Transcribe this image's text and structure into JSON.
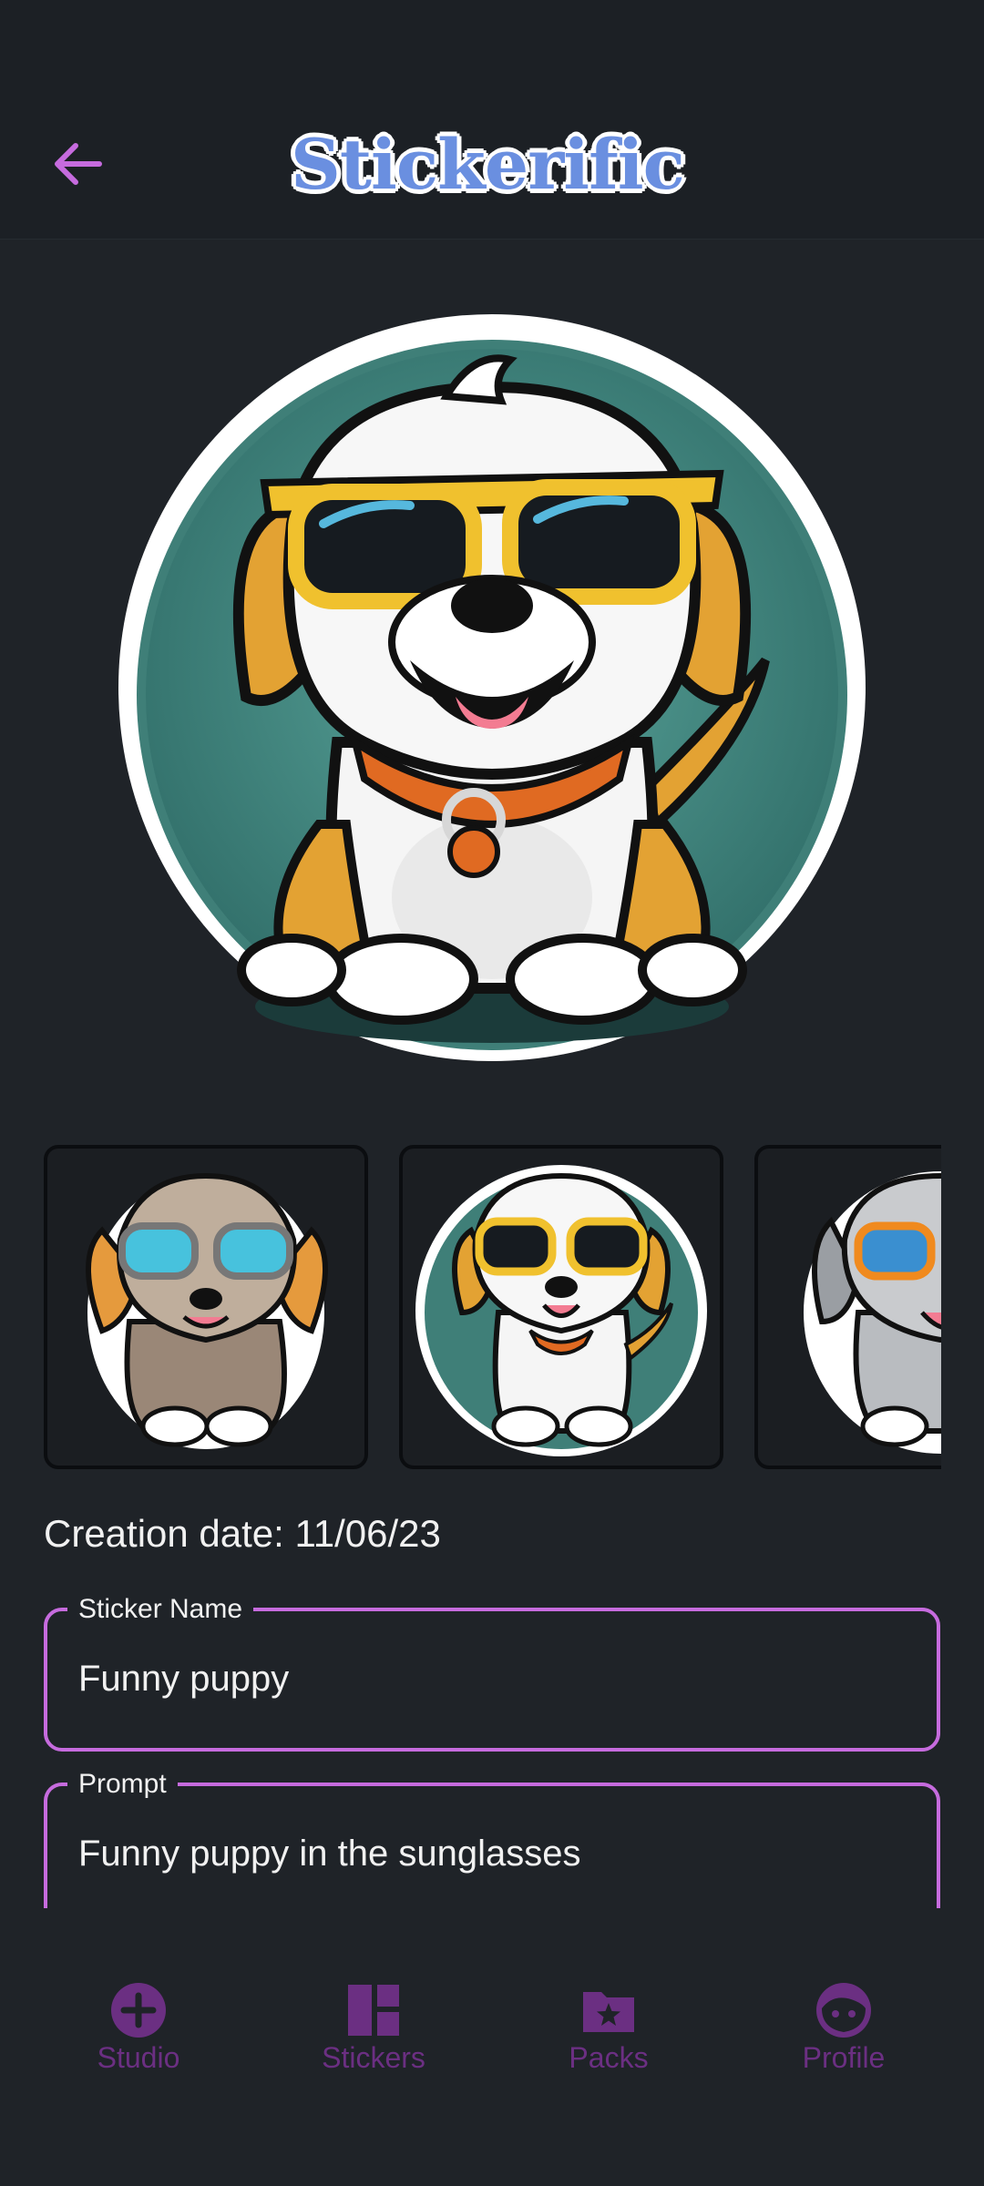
{
  "app": {
    "title": "Stickerific"
  },
  "header": {
    "back_icon": "arrow-left-icon"
  },
  "thumbnails": [
    {
      "name": "brown puppy with blue sunglasses"
    },
    {
      "name": "white puppy with yellow sunglasses"
    },
    {
      "name": "grey puppy with orange sunglasses"
    }
  ],
  "details": {
    "creation_date": "Creation date: 11/06/23",
    "sticker_name_label": "Sticker Name",
    "sticker_name_value": "Funny puppy",
    "prompt_label": "Prompt",
    "prompt_value": "Funny puppy in the sunglasses"
  },
  "nav": {
    "items": [
      {
        "label": "Studio",
        "icon": "plus-circle-icon"
      },
      {
        "label": "Stickers",
        "icon": "dashboard-icon"
      },
      {
        "label": "Packs",
        "icon": "folder-star-icon"
      },
      {
        "label": "Profile",
        "icon": "face-icon"
      }
    ]
  },
  "colors": {
    "accent": "#c66bde",
    "nav_inactive": "#6b2f82",
    "background": "#1f2328",
    "logo_blue": "#6a8fe0"
  }
}
